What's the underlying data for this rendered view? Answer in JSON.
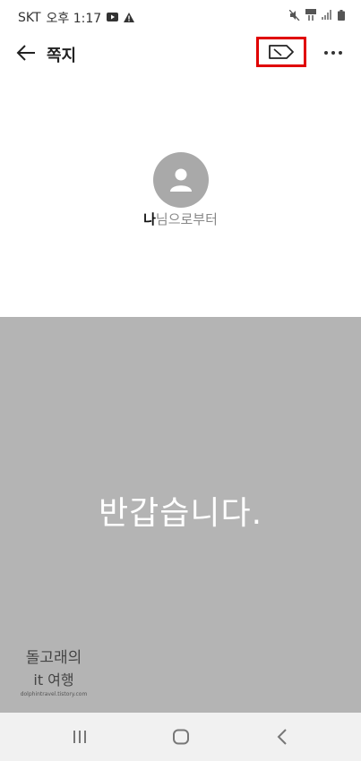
{
  "status_bar": {
    "carrier": "SKT",
    "time": "오후 1:17"
  },
  "header": {
    "title": "쪽지"
  },
  "sender": {
    "name": "나",
    "suffix": "님으로부터"
  },
  "message": {
    "text": "반갑습니다."
  },
  "watermark": {
    "line1": "돌고래의",
    "line2": "it 여행",
    "url": "dolphintravel.tistory.com"
  },
  "colors": {
    "highlight": "#e00000",
    "card_background": "#b4b4b4",
    "avatar": "#a9a9a9"
  }
}
